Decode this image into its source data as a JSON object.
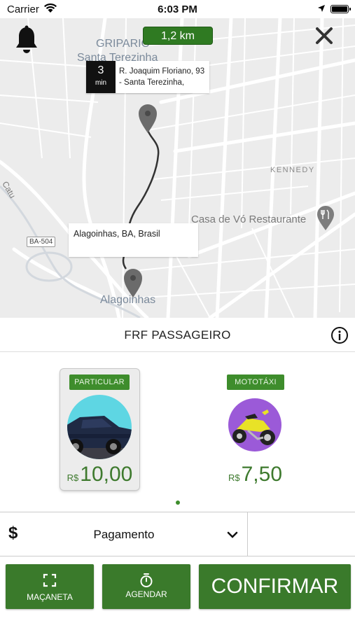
{
  "status_bar": {
    "carrier": "Carrier",
    "time": "6:03 PM"
  },
  "map": {
    "distance": "1,2 km",
    "eta": {
      "value": "3",
      "unit": "min",
      "address": "R. Joaquim Floriano, 93 - Santa Terezinha,"
    },
    "destination": "Alagoinhas, BA, Brasil",
    "labels": {
      "gripario": "GRIPARIO",
      "santa_terezinha": "Santa Terezinha",
      "kennedy": "KENNEDY",
      "restaurant": "Casa de Vó Restaurante",
      "alagoinhas": "Alagoinhas",
      "catu": "Catu",
      "road": "BA-504"
    }
  },
  "service": {
    "title": "FRF PASSAGEIRO"
  },
  "options": [
    {
      "tag": "PARTICULAR",
      "currency": "R$",
      "price": "10,00",
      "selected": true
    },
    {
      "tag": "MOTOTÁXI",
      "currency": "R$",
      "price": "7,50",
      "selected": false
    }
  ],
  "payment": {
    "icon": "$",
    "label": "Pagamento"
  },
  "buttons": {
    "macaneta": "MAÇANETA",
    "agendar": "AGENDAR",
    "confirmar": "CONFIRMAR"
  },
  "colors": {
    "brand_green": "#3a7a2b",
    "tag_green": "#3e8d2c",
    "map_bg": "#ececec"
  }
}
